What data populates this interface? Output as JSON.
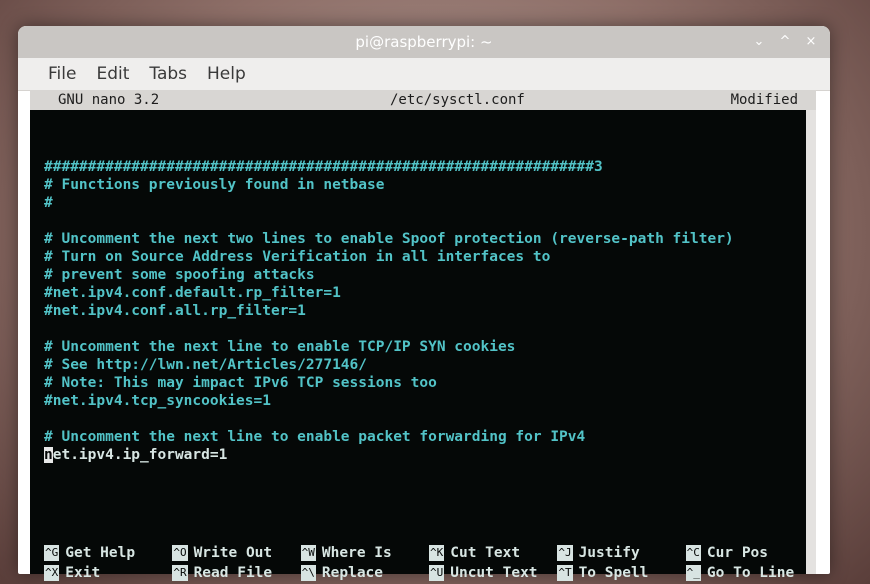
{
  "window": {
    "title": "pi@raspberrypi: ~",
    "controls": [
      "⌄",
      "^",
      "×"
    ]
  },
  "menu": [
    "File",
    "Edit",
    "Tabs",
    "Help"
  ],
  "nano": {
    "version": "GNU nano 3.2",
    "filename": "/etc/sysctl.conf",
    "status": "Modified"
  },
  "lines": [
    {
      "text": "###############################################################3",
      "type": "comment"
    },
    {
      "text": "# Functions previously found in netbase",
      "type": "comment"
    },
    {
      "text": "#",
      "type": "comment"
    },
    {
      "text": "",
      "type": "blank"
    },
    {
      "text": "# Uncomment the next two lines to enable Spoof protection (reverse-path filter)",
      "type": "comment"
    },
    {
      "text": "# Turn on Source Address Verification in all interfaces to",
      "type": "comment"
    },
    {
      "text": "# prevent some spoofing attacks",
      "type": "comment"
    },
    {
      "text": "#net.ipv4.conf.default.rp_filter=1",
      "type": "comment"
    },
    {
      "text": "#net.ipv4.conf.all.rp_filter=1",
      "type": "comment"
    },
    {
      "text": "",
      "type": "blank"
    },
    {
      "text": "# Uncomment the next line to enable TCP/IP SYN cookies",
      "type": "comment"
    },
    {
      "text": "# See http://lwn.net/Articles/277146/",
      "type": "comment"
    },
    {
      "text": "# Note: This may impact IPv6 TCP sessions too",
      "type": "comment"
    },
    {
      "text": "#net.ipv4.tcp_syncookies=1",
      "type": "comment"
    },
    {
      "text": "",
      "type": "blank"
    },
    {
      "text": "# Uncomment the next line to enable packet forwarding for IPv4",
      "type": "comment"
    },
    {
      "text": "net.ipv4.ip_forward=1",
      "type": "code",
      "cursor": true
    }
  ],
  "shortcuts": [
    {
      "key": "^G",
      "label": "Get Help"
    },
    {
      "key": "^O",
      "label": "Write Out"
    },
    {
      "key": "^W",
      "label": "Where Is"
    },
    {
      "key": "^K",
      "label": "Cut Text"
    },
    {
      "key": "^J",
      "label": "Justify"
    },
    {
      "key": "^C",
      "label": "Cur Pos"
    },
    {
      "key": "^X",
      "label": "Exit"
    },
    {
      "key": "^R",
      "label": "Read File"
    },
    {
      "key": "^\\",
      "label": "Replace"
    },
    {
      "key": "^U",
      "label": "Uncut Text"
    },
    {
      "key": "^T",
      "label": "To Spell"
    },
    {
      "key": "^_",
      "label": "Go To Line"
    }
  ]
}
